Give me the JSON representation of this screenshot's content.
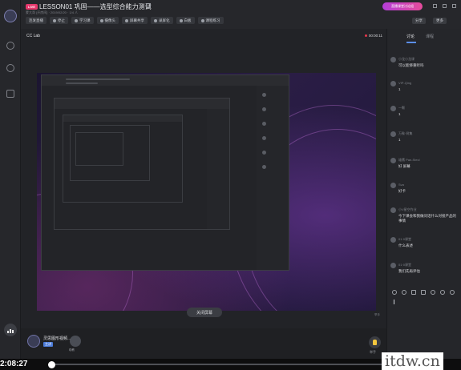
{
  "header": {
    "live_badge": "LIVE",
    "title": "LESSON01 巩固——选型综合能力测试",
    "subtitle": "蒙大哥 [开房间] · 2019/02/20 · 1/4 人",
    "promo": "直播课堂讨论组",
    "share_label": "分享",
    "more_label": "更多",
    "tools": [
      "连发直播",
      "停止",
      "学习课",
      "摄像头",
      "屏幕共享",
      "录屏化",
      "白板",
      "课程练习"
    ]
  },
  "stage": {
    "cc_label": "CC Lab",
    "rec_time": "00:00:11",
    "end_button": "关闭屏幕",
    "side_tip": "举手"
  },
  "presenter": {
    "name": "灵思图形视频...",
    "tag": "主讲",
    "thumb_label": "助教",
    "hand_label": "举手"
  },
  "playback": {
    "time": "2:08:27",
    "progress": 0.05
  },
  "watermark": "itdw.cn",
  "chat": {
    "tabs": [
      "讨论",
      "课程"
    ],
    "messages": [
      {
        "name": "小龙小龙课",
        "text": "可以能够重听吗"
      },
      {
        "name": "VIP-Qing",
        "text": "1"
      },
      {
        "name": "一颗",
        "text": "1"
      },
      {
        "name": "万象·树集",
        "text": "1"
      },
      {
        "name": "雄鹰 Pan-Stecl",
        "text": "好 屏幕"
      },
      {
        "name": "Sva",
        "text": "好卡"
      },
      {
        "name": "小V星空作业",
        "text": "今下课会和我做问话什么对接产品的事情"
      },
      {
        "name": "01·0课堂",
        "text": "什么表述"
      },
      {
        "name": "01·0课堂",
        "text": "我们先再评估"
      }
    ]
  }
}
